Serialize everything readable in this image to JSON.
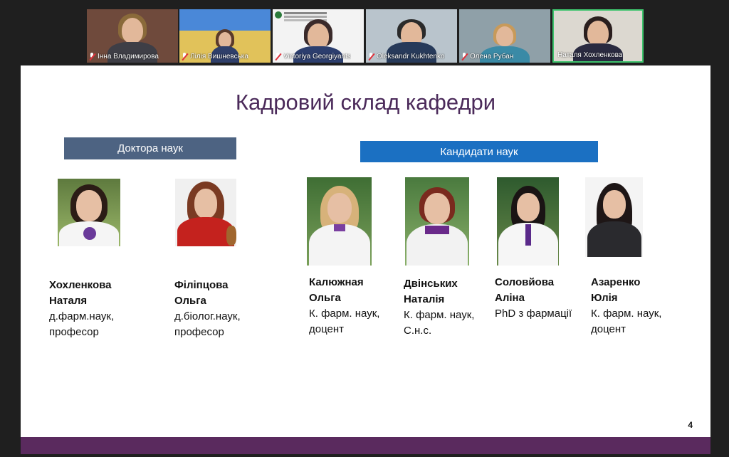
{
  "participants": [
    {
      "name": "Інна Владимирова",
      "colors": {
        "bg": "#6f4a3c",
        "hair": "#8a6a3a",
        "body": "#3e3e46"
      }
    },
    {
      "name": "Лілія Вишневська",
      "colors": {
        "bg": "#e1c25a",
        "hair": "#5a3a2a",
        "body": "#2f3f6a"
      }
    },
    {
      "name": "Victoriya Georgiyants",
      "colors": {
        "bg": "#f3f3f3",
        "hair": "#3a2a2a",
        "body": "#2c3e6e"
      }
    },
    {
      "name": "Oleksandr Kukhtenko",
      "colors": {
        "bg": "#b9c4cc",
        "hair": "#2a2a2a",
        "body": "#273a5a"
      }
    },
    {
      "name": "Олена Рубан",
      "colors": {
        "bg": "#8fa0a8",
        "hair": "#c89a5a",
        "body": "#3a8aa6"
      }
    },
    {
      "name": "Наталя Хохленкова",
      "colors": {
        "bg": "#dcd8d0",
        "hair": "#2a1e1e",
        "body": "#2a2a40"
      }
    }
  ],
  "slide": {
    "title": "Кадровий склад кафедри",
    "doctors_header": "Доктора наук",
    "candidates_header": "Кандидати  наук",
    "page_number": "4",
    "people": [
      {
        "name_line1": "Хохленкова",
        "name_line2": "Наталя",
        "degree_line1": "д.фарм.наук,",
        "degree_line2": "професор"
      },
      {
        "name_line1": "Філіпцова",
        "name_line2": "Ольга",
        "degree_line1": "д.біолог.наук,",
        "degree_line2": "професор"
      },
      {
        "name_line1": "Калюжная",
        "name_line2": "Ольга",
        "degree_line1": "К. фарм. наук,",
        "degree_line2": "доцент"
      },
      {
        "name_line1": "Двінських",
        "name_line2": "Наталія",
        "degree_line1": "К. фарм. наук,",
        "degree_line2": "С.н.с."
      },
      {
        "name_line1": "Соловйова",
        "name_line2": "Аліна",
        "degree_line1": "PhD з фармації",
        "degree_line2": ""
      },
      {
        "name_line1": "Азаренко",
        "name_line2": "Юлія",
        "degree_line1": "К. фарм. наук,",
        "degree_line2": "доцент"
      }
    ]
  },
  "colors": {
    "title": "#4b2a5a",
    "doctors_header_bg": "#4d6382",
    "candidates_header_bg": "#1b70c2",
    "footer_bar": "#5a2a5e",
    "active_speaker_border": "#3ec46d"
  }
}
